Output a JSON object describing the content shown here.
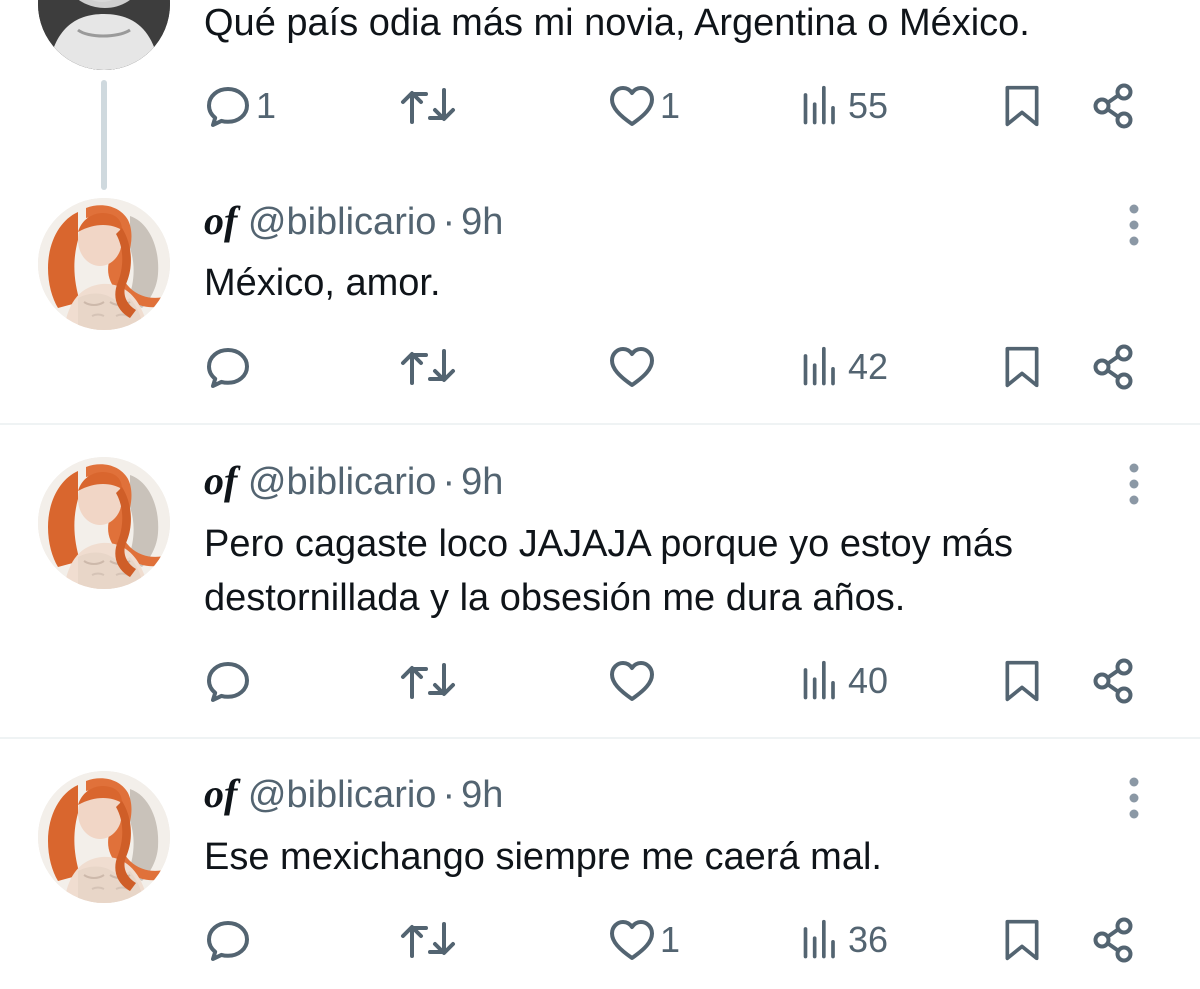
{
  "tweets": [
    {
      "text": "Qué país odia más mi novia, Argentina o México.",
      "replies": "1",
      "reposts": "",
      "likes": "1",
      "views": "55"
    },
    {
      "name": "of",
      "handle": "@biblicario",
      "separator": "·",
      "time": "9h",
      "text": "México, amor.",
      "replies": "",
      "reposts": "",
      "likes": "",
      "views": "42"
    },
    {
      "name": "of",
      "handle": "@biblicario",
      "separator": "·",
      "time": "9h",
      "text": "Pero cagaste loco JAJAJA porque yo estoy más\ndestornillada y la obsesión me dura años.",
      "replies": "",
      "reposts": "",
      "likes": "",
      "views": "40"
    },
    {
      "name": "of",
      "handle": "@biblicario",
      "separator": "·",
      "time": "9h",
      "text": "Ese mexichango siempre me caerá mal.",
      "replies": "",
      "reposts": "",
      "likes": "1",
      "views": "36"
    }
  ],
  "icons": {
    "reply": "speech-bubble",
    "repost": "two-arrows-loop",
    "like": "heart",
    "views": "bar-chart",
    "bookmark": "bookmark",
    "share": "share-nodes",
    "more": "vertical-ellipsis"
  },
  "colors": {
    "text_primary": "#0f1419",
    "text_secondary": "#536471",
    "thread_line": "#cfd9de",
    "divider": "#eff3f4",
    "avatar_hair": "#d9662e"
  }
}
